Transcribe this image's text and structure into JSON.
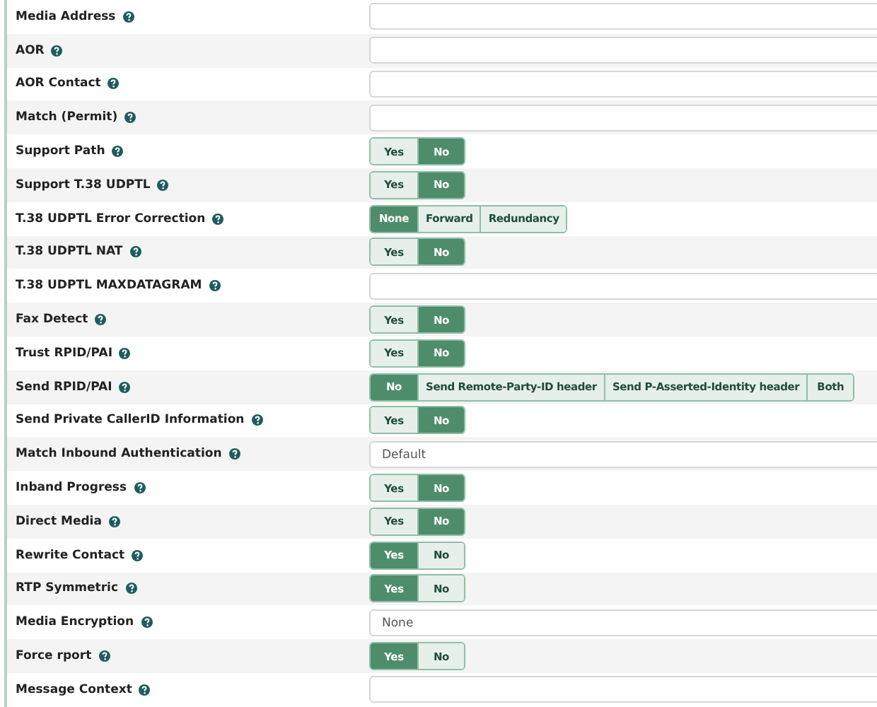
{
  "rows": [
    {
      "label": "Media Address",
      "kind": "text"
    },
    {
      "label": "AOR",
      "kind": "text"
    },
    {
      "label": "AOR Contact",
      "kind": "text"
    },
    {
      "label": "Match (Permit)",
      "kind": "text"
    },
    {
      "label": "Support Path",
      "kind": "toggle",
      "options": [
        {
          "label": "Yes",
          "selected": false
        },
        {
          "label": "No",
          "selected": true
        }
      ]
    },
    {
      "label": "Support T.38 UDPTL",
      "kind": "toggle",
      "options": [
        {
          "label": "Yes",
          "selected": false
        },
        {
          "label": "No",
          "selected": true
        }
      ]
    },
    {
      "label": "T.38 UDPTL Error Correction",
      "kind": "toggle",
      "options": [
        {
          "label": "None",
          "selected": true
        },
        {
          "label": "Forward",
          "selected": false
        },
        {
          "label": "Redundancy",
          "selected": false
        }
      ]
    },
    {
      "label": "T.38 UDPTL NAT",
      "kind": "toggle",
      "options": [
        {
          "label": "Yes",
          "selected": false
        },
        {
          "label": "No",
          "selected": true
        }
      ]
    },
    {
      "label": "T.38 UDPTL MAXDATAGRAM",
      "kind": "text"
    },
    {
      "label": "Fax Detect",
      "kind": "toggle",
      "options": [
        {
          "label": "Yes",
          "selected": false
        },
        {
          "label": "No",
          "selected": true
        }
      ]
    },
    {
      "label": "Trust RPID/PAI",
      "kind": "toggle",
      "options": [
        {
          "label": "Yes",
          "selected": false
        },
        {
          "label": "No",
          "selected": true
        }
      ]
    },
    {
      "label": "Send RPID/PAI",
      "kind": "toggle",
      "options": [
        {
          "label": "No",
          "selected": true
        },
        {
          "label": "Send Remote-Party-ID header",
          "selected": false
        },
        {
          "label": "Send P-Asserted-Identity header",
          "selected": false
        },
        {
          "label": "Both",
          "selected": false
        }
      ]
    },
    {
      "label": "Send Private CallerID Information",
      "kind": "toggle",
      "options": [
        {
          "label": "Yes",
          "selected": false
        },
        {
          "label": "No",
          "selected": true
        }
      ]
    },
    {
      "label": "Match Inbound Authentication",
      "kind": "select",
      "value": "Default"
    },
    {
      "label": "Inband Progress",
      "kind": "toggle",
      "options": [
        {
          "label": "Yes",
          "selected": false
        },
        {
          "label": "No",
          "selected": true
        }
      ]
    },
    {
      "label": "Direct Media",
      "kind": "toggle",
      "options": [
        {
          "label": "Yes",
          "selected": false
        },
        {
          "label": "No",
          "selected": true
        }
      ]
    },
    {
      "label": "Rewrite Contact",
      "kind": "toggle",
      "options": [
        {
          "label": "Yes",
          "selected": true
        },
        {
          "label": "No",
          "selected": false
        }
      ]
    },
    {
      "label": "RTP Symmetric",
      "kind": "toggle",
      "options": [
        {
          "label": "Yes",
          "selected": true
        },
        {
          "label": "No",
          "selected": false
        }
      ]
    },
    {
      "label": "Media Encryption",
      "kind": "select",
      "value": "None"
    },
    {
      "label": "Force rport",
      "kind": "toggle",
      "options": [
        {
          "label": "Yes",
          "selected": true
        },
        {
          "label": "No",
          "selected": false
        }
      ]
    },
    {
      "label": "Message Context",
      "kind": "text"
    }
  ]
}
